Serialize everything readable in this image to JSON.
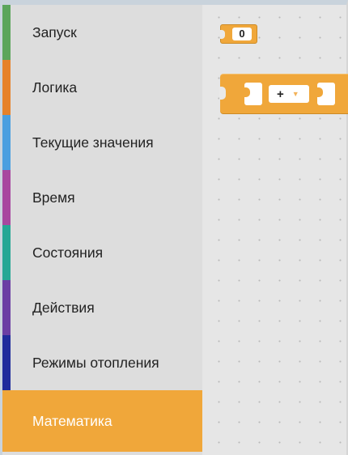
{
  "toolbox": {
    "categories": [
      {
        "label": "Запуск",
        "color": "#5ba55b"
      },
      {
        "label": "Логика",
        "color": "#e6822a"
      },
      {
        "label": "Текущие значения",
        "color": "#4a9fe0"
      },
      {
        "label": "Время",
        "color": "#a8479f"
      },
      {
        "label": "Состояния",
        "color": "#25a795"
      },
      {
        "label": "Действия",
        "color": "#6b3ea4"
      },
      {
        "label": "Режимы отопления",
        "color": "#1f2b9c"
      },
      {
        "label": "Математика",
        "color": "#f0a73a",
        "selected": true
      }
    ]
  },
  "workspace": {
    "number_block": {
      "value": "0",
      "color": "#f0a73a"
    },
    "operator_block": {
      "operator": "+",
      "color": "#f0a73a",
      "dropdown_icon": "triangle-down-icon"
    }
  }
}
